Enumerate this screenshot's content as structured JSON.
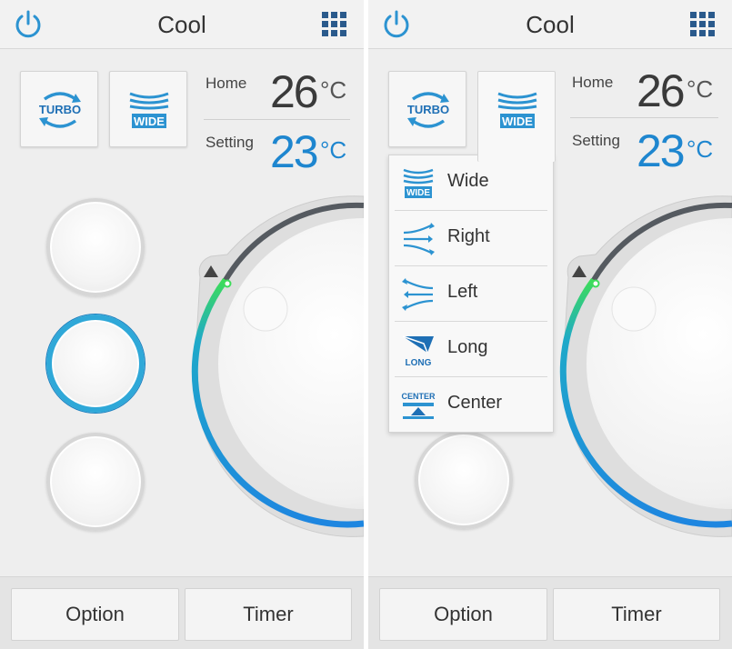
{
  "colors": {
    "accent": "#1e86cf",
    "active_ring": "#2fa8d8",
    "indicator": "#3ddc5a",
    "background": "#eeeeee"
  },
  "screens": [
    {
      "header": {
        "title": "Cool",
        "power_icon": "power-icon",
        "menu_icon": "grid-menu-icon"
      },
      "modes": {
        "turbo_label": "TURBO",
        "wide_label": "WIDE"
      },
      "temps": {
        "home_label": "Home",
        "home_value": "26",
        "setting_label": "Setting",
        "setting_value": "23",
        "unit": "°C"
      },
      "fan_speed_selected": 2,
      "footer": {
        "option_label": "Option",
        "timer_label": "Timer"
      }
    },
    {
      "header": {
        "title": "Cool",
        "power_icon": "power-icon",
        "menu_icon": "grid-menu-icon"
      },
      "modes": {
        "turbo_label": "TURBO",
        "wide_label": "WIDE"
      },
      "temps": {
        "home_label": "Home",
        "home_value": "26",
        "setting_label": "Setting",
        "setting_value": "23",
        "unit": "°C"
      },
      "airflow_menu": {
        "items": [
          {
            "label": "Wide",
            "icon_text": "WIDE",
            "icon": "wide-airflow-icon"
          },
          {
            "label": "Right",
            "icon_text": "",
            "icon": "right-airflow-icon"
          },
          {
            "label": "Left",
            "icon_text": "",
            "icon": "left-airflow-icon"
          },
          {
            "label": "Long",
            "icon_text": "LONG",
            "icon": "long-airflow-icon"
          },
          {
            "label": "Center",
            "icon_text": "CENTER",
            "icon": "center-airflow-icon"
          }
        ]
      },
      "footer": {
        "option_label": "Option",
        "timer_label": "Timer"
      }
    }
  ]
}
